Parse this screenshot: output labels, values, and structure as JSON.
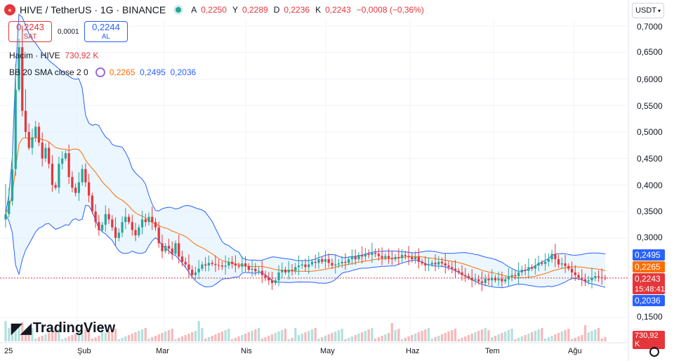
{
  "header": {
    "symbol_text": "HIVE / TetherUS · 1G · BINANCE",
    "logo_glyph": "«",
    "ohlc": [
      {
        "k": "A",
        "v": "0,2250"
      },
      {
        "k": "Y",
        "v": "0,2289"
      },
      {
        "k": "D",
        "v": "0,2236"
      },
      {
        "k": "K",
        "v": "0,2243"
      },
      {
        "k": "",
        "v": "−0,0008 (−0,36%)"
      }
    ]
  },
  "trade": {
    "sell_price": "0,2243",
    "sell_label": "SAT",
    "buy_price": "0,2244",
    "buy_label": "AL",
    "spread": "0,0001"
  },
  "indicators": {
    "volume_label": "Hacim · HIVE",
    "volume_value": "730,92 K",
    "bb_label": "BB 20 SMA close 2 0",
    "bb_basis": "0,2265",
    "bb_upper": "0,2495",
    "bb_lower": "0,2036"
  },
  "currency_button": "USDT",
  "price_scale": [
    "0,7000",
    "0,6500",
    "0,6000",
    "0,5500",
    "0,5000",
    "0,4500",
    "0,4000",
    "0,3500",
    "0,3000",
    "0,1500"
  ],
  "tags": {
    "upper": "0,2495",
    "basis": "0,2265",
    "last": "0,2243",
    "countdown": "15:48:41",
    "lower": "0,2036",
    "volume": "730,92 K"
  },
  "time_axis": [
    "25",
    "Şub",
    "Mar",
    "Nis",
    "May",
    "Haz",
    "Tem",
    "Ağu"
  ],
  "watermark": "TradingView",
  "colors": {
    "up": "#26a69a",
    "down": "#e5363b",
    "basis": "#ff6d00",
    "band": "#2962ff",
    "fill": "#e3f2fd"
  },
  "chart_data": {
    "type": "candlestick",
    "title": "HIVE / TetherUS · 1G · BINANCE",
    "ylim": [
      0.15,
      0.72
    ],
    "x_ticks": [
      "25",
      "Şub",
      "Mar",
      "Nis",
      "May",
      "Haz",
      "Tem",
      "Ağu"
    ],
    "y_ticks": [
      0.7,
      0.65,
      0.6,
      0.55,
      0.5,
      0.45,
      0.4,
      0.35,
      0.3,
      0.15
    ],
    "close": [
      0.345,
      0.37,
      0.43,
      0.58,
      0.66,
      0.54,
      0.5,
      0.47,
      0.49,
      0.51,
      0.48,
      0.45,
      0.47,
      0.44,
      0.4,
      0.395,
      0.44,
      0.45,
      0.46,
      0.415,
      0.395,
      0.385,
      0.405,
      0.43,
      0.405,
      0.38,
      0.35,
      0.33,
      0.315,
      0.325,
      0.345,
      0.335,
      0.32,
      0.3,
      0.31,
      0.33,
      0.34,
      0.33,
      0.315,
      0.305,
      0.32,
      0.335,
      0.33,
      0.34,
      0.33,
      0.32,
      0.29,
      0.275,
      0.285,
      0.28,
      0.27,
      0.29,
      0.265,
      0.255,
      0.25,
      0.24,
      0.23,
      0.235,
      0.242,
      0.25,
      0.248,
      0.253,
      0.251,
      0.249,
      0.248,
      0.246,
      0.248,
      0.255,
      0.251,
      0.248,
      0.246,
      0.252,
      0.247,
      0.24,
      0.242,
      0.237,
      0.238,
      0.23,
      0.225,
      0.22,
      0.215,
      0.22,
      0.235,
      0.24,
      0.235,
      0.24,
      0.238,
      0.245,
      0.248,
      0.25,
      0.245,
      0.25,
      0.255,
      0.253,
      0.26,
      0.255,
      0.26,
      0.253,
      0.248,
      0.25,
      0.252,
      0.255,
      0.253,
      0.26,
      0.265,
      0.26,
      0.268,
      0.265,
      0.27,
      0.268,
      0.272,
      0.27,
      0.266,
      0.262,
      0.266,
      0.262,
      0.26,
      0.264,
      0.262,
      0.268,
      0.266,
      0.264,
      0.26,
      0.264,
      0.255,
      0.252,
      0.248,
      0.25,
      0.253,
      0.25,
      0.255,
      0.252,
      0.248,
      0.245,
      0.242,
      0.238,
      0.235,
      0.23,
      0.228,
      0.225,
      0.22,
      0.222,
      0.218,
      0.215,
      0.223,
      0.22,
      0.225,
      0.22,
      0.223,
      0.218,
      0.222,
      0.227,
      0.23,
      0.228,
      0.235,
      0.24,
      0.238,
      0.245,
      0.242,
      0.248,
      0.253,
      0.251,
      0.255,
      0.26,
      0.27,
      0.26,
      0.25,
      0.252,
      0.247,
      0.242,
      0.235,
      0.23,
      0.225,
      0.222,
      0.218,
      0.22,
      0.225,
      0.228,
      0.226,
      0.225,
      0.2243
    ],
    "bb_basis_last": 0.2265,
    "bb_upper_last": 0.2495,
    "bb_lower_last": 0.2036,
    "last_price": 0.2243,
    "volume_last": "730,92 K"
  }
}
